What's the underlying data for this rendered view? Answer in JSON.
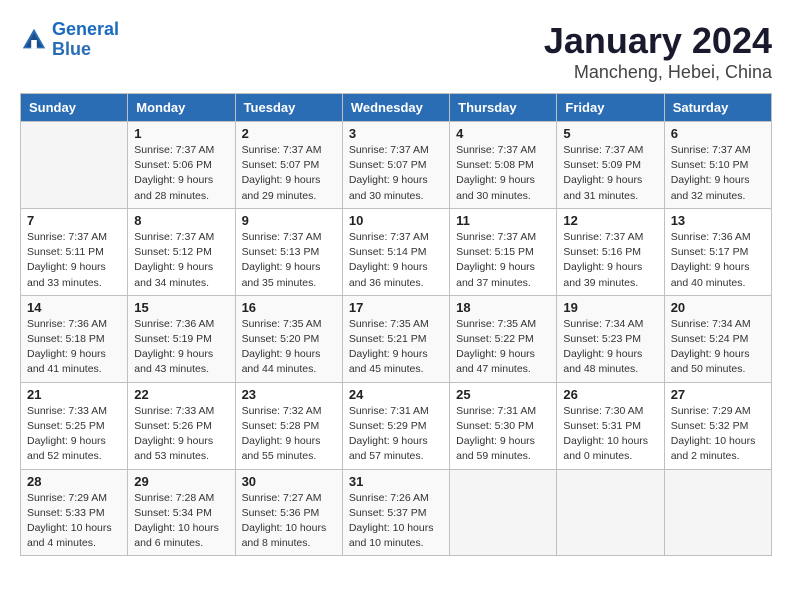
{
  "header": {
    "logo_line1": "General",
    "logo_line2": "Blue",
    "month": "January 2024",
    "location": "Mancheng, Hebei, China"
  },
  "weekdays": [
    "Sunday",
    "Monday",
    "Tuesday",
    "Wednesday",
    "Thursday",
    "Friday",
    "Saturday"
  ],
  "weeks": [
    [
      {
        "day": "",
        "info": ""
      },
      {
        "day": "1",
        "info": "Sunrise: 7:37 AM\nSunset: 5:06 PM\nDaylight: 9 hours\nand 28 minutes."
      },
      {
        "day": "2",
        "info": "Sunrise: 7:37 AM\nSunset: 5:07 PM\nDaylight: 9 hours\nand 29 minutes."
      },
      {
        "day": "3",
        "info": "Sunrise: 7:37 AM\nSunset: 5:07 PM\nDaylight: 9 hours\nand 30 minutes."
      },
      {
        "day": "4",
        "info": "Sunrise: 7:37 AM\nSunset: 5:08 PM\nDaylight: 9 hours\nand 30 minutes."
      },
      {
        "day": "5",
        "info": "Sunrise: 7:37 AM\nSunset: 5:09 PM\nDaylight: 9 hours\nand 31 minutes."
      },
      {
        "day": "6",
        "info": "Sunrise: 7:37 AM\nSunset: 5:10 PM\nDaylight: 9 hours\nand 32 minutes."
      }
    ],
    [
      {
        "day": "7",
        "info": "Sunrise: 7:37 AM\nSunset: 5:11 PM\nDaylight: 9 hours\nand 33 minutes."
      },
      {
        "day": "8",
        "info": "Sunrise: 7:37 AM\nSunset: 5:12 PM\nDaylight: 9 hours\nand 34 minutes."
      },
      {
        "day": "9",
        "info": "Sunrise: 7:37 AM\nSunset: 5:13 PM\nDaylight: 9 hours\nand 35 minutes."
      },
      {
        "day": "10",
        "info": "Sunrise: 7:37 AM\nSunset: 5:14 PM\nDaylight: 9 hours\nand 36 minutes."
      },
      {
        "day": "11",
        "info": "Sunrise: 7:37 AM\nSunset: 5:15 PM\nDaylight: 9 hours\nand 37 minutes."
      },
      {
        "day": "12",
        "info": "Sunrise: 7:37 AM\nSunset: 5:16 PM\nDaylight: 9 hours\nand 39 minutes."
      },
      {
        "day": "13",
        "info": "Sunrise: 7:36 AM\nSunset: 5:17 PM\nDaylight: 9 hours\nand 40 minutes."
      }
    ],
    [
      {
        "day": "14",
        "info": "Sunrise: 7:36 AM\nSunset: 5:18 PM\nDaylight: 9 hours\nand 41 minutes."
      },
      {
        "day": "15",
        "info": "Sunrise: 7:36 AM\nSunset: 5:19 PM\nDaylight: 9 hours\nand 43 minutes."
      },
      {
        "day": "16",
        "info": "Sunrise: 7:35 AM\nSunset: 5:20 PM\nDaylight: 9 hours\nand 44 minutes."
      },
      {
        "day": "17",
        "info": "Sunrise: 7:35 AM\nSunset: 5:21 PM\nDaylight: 9 hours\nand 45 minutes."
      },
      {
        "day": "18",
        "info": "Sunrise: 7:35 AM\nSunset: 5:22 PM\nDaylight: 9 hours\nand 47 minutes."
      },
      {
        "day": "19",
        "info": "Sunrise: 7:34 AM\nSunset: 5:23 PM\nDaylight: 9 hours\nand 48 minutes."
      },
      {
        "day": "20",
        "info": "Sunrise: 7:34 AM\nSunset: 5:24 PM\nDaylight: 9 hours\nand 50 minutes."
      }
    ],
    [
      {
        "day": "21",
        "info": "Sunrise: 7:33 AM\nSunset: 5:25 PM\nDaylight: 9 hours\nand 52 minutes."
      },
      {
        "day": "22",
        "info": "Sunrise: 7:33 AM\nSunset: 5:26 PM\nDaylight: 9 hours\nand 53 minutes."
      },
      {
        "day": "23",
        "info": "Sunrise: 7:32 AM\nSunset: 5:28 PM\nDaylight: 9 hours\nand 55 minutes."
      },
      {
        "day": "24",
        "info": "Sunrise: 7:31 AM\nSunset: 5:29 PM\nDaylight: 9 hours\nand 57 minutes."
      },
      {
        "day": "25",
        "info": "Sunrise: 7:31 AM\nSunset: 5:30 PM\nDaylight: 9 hours\nand 59 minutes."
      },
      {
        "day": "26",
        "info": "Sunrise: 7:30 AM\nSunset: 5:31 PM\nDaylight: 10 hours\nand 0 minutes."
      },
      {
        "day": "27",
        "info": "Sunrise: 7:29 AM\nSunset: 5:32 PM\nDaylight: 10 hours\nand 2 minutes."
      }
    ],
    [
      {
        "day": "28",
        "info": "Sunrise: 7:29 AM\nSunset: 5:33 PM\nDaylight: 10 hours\nand 4 minutes."
      },
      {
        "day": "29",
        "info": "Sunrise: 7:28 AM\nSunset: 5:34 PM\nDaylight: 10 hours\nand 6 minutes."
      },
      {
        "day": "30",
        "info": "Sunrise: 7:27 AM\nSunset: 5:36 PM\nDaylight: 10 hours\nand 8 minutes."
      },
      {
        "day": "31",
        "info": "Sunrise: 7:26 AM\nSunset: 5:37 PM\nDaylight: 10 hours\nand 10 minutes."
      },
      {
        "day": "",
        "info": ""
      },
      {
        "day": "",
        "info": ""
      },
      {
        "day": "",
        "info": ""
      }
    ]
  ]
}
